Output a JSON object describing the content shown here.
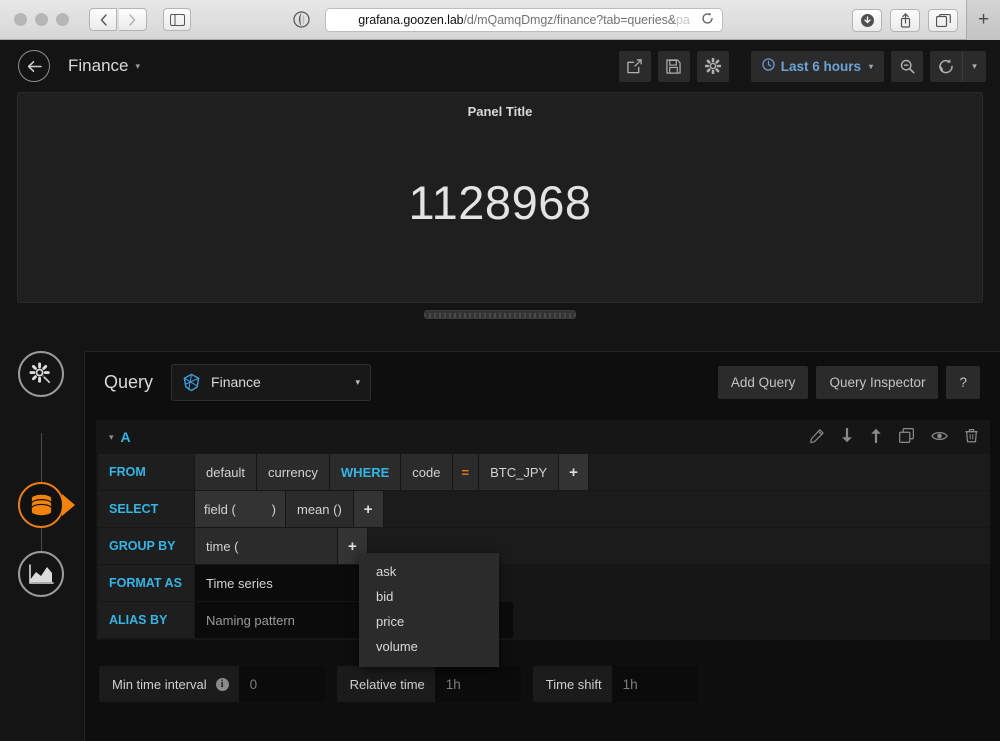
{
  "browser": {
    "url_host": "grafana.goozen.lab",
    "url_path": "/d/mQamqDmgz/finance?tab=queries&",
    "url_tail": "pa",
    "back_icon": "chevron-left-icon",
    "forward_icon": "chevron-right-icon",
    "sidebar_icon": "sidebar-toggle-icon",
    "shield_icon": "privacy-shield-icon",
    "reload_icon": "reload-icon",
    "downloads_icon": "downloads-icon",
    "share_icon": "share-icon",
    "tabs_icon": "show-tabs-icon",
    "newtab_label": "+"
  },
  "dashboard": {
    "title": "Finance",
    "back_label": "←",
    "caret": "▾",
    "toolbar": {
      "share_icon": "share-dashboard-icon",
      "save_icon": "save-dashboard-icon",
      "settings_icon": "gear-icon",
      "time_range": "Last 6 hours",
      "clock_icon": "clock-icon",
      "zoom_out_icon": "search-minus-icon",
      "refresh_icon": "refresh-icon",
      "refresh_caret": "▾"
    }
  },
  "panel": {
    "title": "Panel Title",
    "value": "1128968",
    "resize_handle": "panel-resize-handle"
  },
  "edit_rail": {
    "items": [
      {
        "name": "queries-tab",
        "icon": "database-icon",
        "active": true
      },
      {
        "name": "visualization-tab",
        "icon": "graph-icon",
        "active": false
      },
      {
        "name": "panel-options-tab",
        "icon": "gear-wrench-icon",
        "active": false
      }
    ]
  },
  "query_editor": {
    "heading": "Query",
    "datasource": "Finance",
    "datasource_icon": "influxdb-icon",
    "datasource_caret": "▾",
    "add_query_label": "Add Query",
    "query_inspector_label": "Query Inspector",
    "help_label": "?",
    "row": {
      "letter": "A",
      "collapse_caret": "▾",
      "actions": [
        {
          "name": "edit-query-icon",
          "glyph": "✎"
        },
        {
          "name": "move-query-down-icon",
          "glyph": "↓"
        },
        {
          "name": "move-query-up-icon",
          "glyph": "↑"
        },
        {
          "name": "duplicate-query-icon",
          "glyph": "❐"
        },
        {
          "name": "toggle-query-visibility-icon",
          "glyph": "◉"
        },
        {
          "name": "delete-query-icon",
          "glyph": "Ὕ1"
        }
      ]
    },
    "lines": {
      "from": {
        "key": "FROM",
        "policy": "default",
        "measurement": "currency",
        "where_kw": "WHERE",
        "tag_key": "code",
        "operator": "=",
        "tag_value": "BTC_JPY",
        "add": "+"
      },
      "select": {
        "key": "SELECT",
        "field_prefix": "field (",
        "field_value": "",
        "field_suffix": ")",
        "aggregate": "mean ()",
        "add": "+"
      },
      "group_by": {
        "key": "GROUP BY",
        "time": "time (",
        "add": "+"
      },
      "format_as": {
        "key": "FORMAT AS",
        "value": "Time series"
      },
      "alias_by": {
        "key": "ALIAS BY",
        "placeholder": "Naming pattern",
        "value": ""
      }
    },
    "field_dropdown": {
      "open": true,
      "options": [
        "ask",
        "bid",
        "price",
        "volume"
      ]
    },
    "options": [
      {
        "label": "Min time interval",
        "info_icon": "info-icon",
        "placeholder": "0",
        "value": ""
      },
      {
        "label": "Relative time",
        "info_icon": null,
        "placeholder": "1h",
        "value": ""
      },
      {
        "label": "Time shift",
        "info_icon": null,
        "placeholder": "1h",
        "value": ""
      }
    ]
  },
  "colors": {
    "accent_blue": "#33b5e5",
    "accent_orange": "#eb7b18",
    "app_bg": "#141414",
    "panel_bg": "#1f1f1f",
    "editor_bg": "#0e0e0e"
  }
}
